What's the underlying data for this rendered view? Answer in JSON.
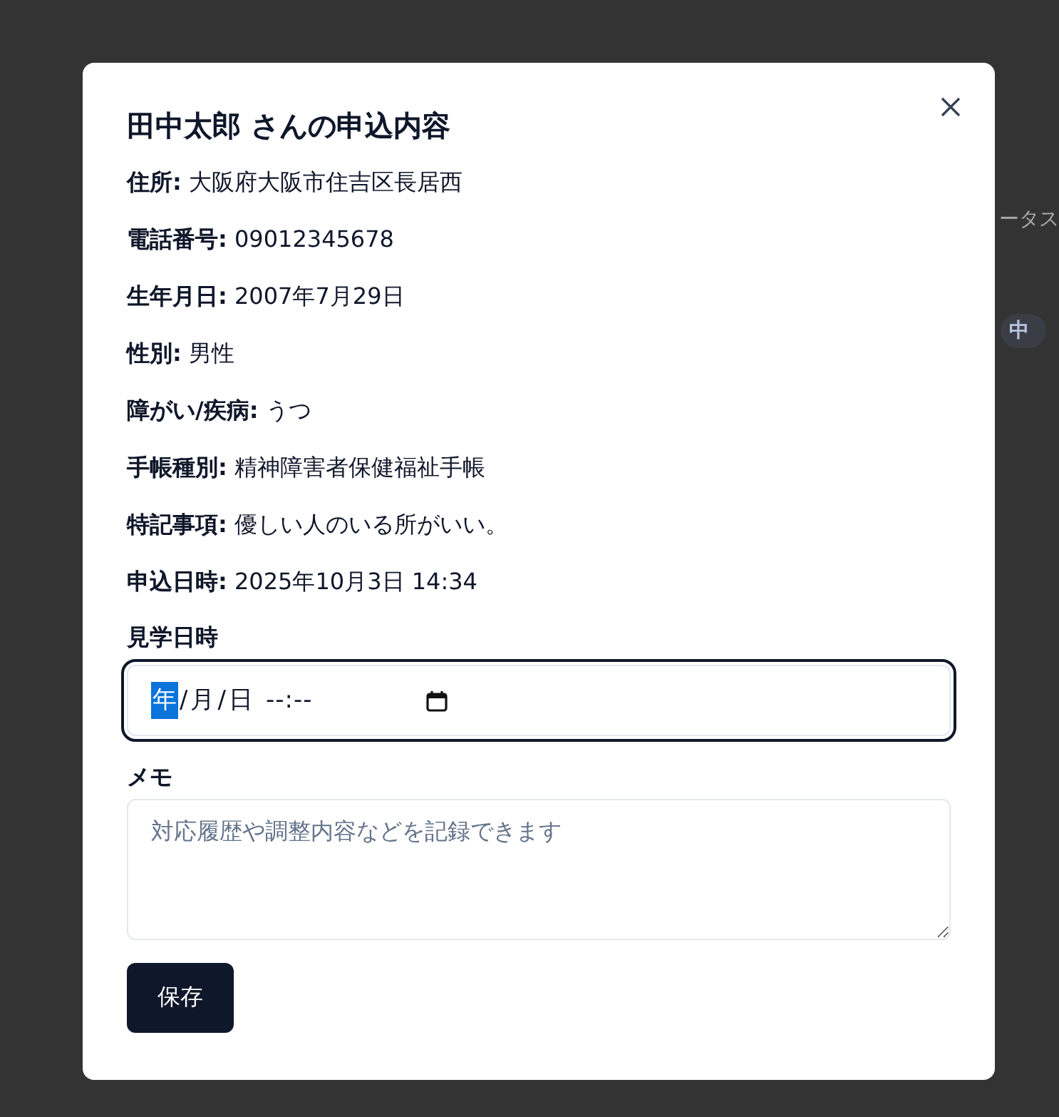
{
  "background": {
    "column_heading": "ータス",
    "status_badge": "中"
  },
  "dialog": {
    "title": "田中太郎 さんの申込内容",
    "details": [
      {
        "text": "**住所:** 大阪府大阪市住吉区長居西"
      },
      {
        "text": "**電話番号:** 09012345678"
      },
      {
        "text": "**生年月日:** 2007年7月29日"
      },
      {
        "text": "**性別:** 男性"
      },
      {
        "text": "**障がい/疾病:** うつ"
      },
      {
        "text": "**手帳種別:** 精神障害者保健福祉手帳"
      },
      {
        "text": "**特記事項:** 優しい人のいる所がいい。"
      },
      {
        "text": "**申込日時:** 2025年10月3日 14:34"
      }
    ],
    "visit_field": {
      "label": "見学日時",
      "focused": true,
      "segments": [
        {
          "text": "年",
          "selected": true
        },
        {
          "text": "/",
          "selected": false
        },
        {
          "text": "月",
          "selected": false
        },
        {
          "text": "/",
          "selected": false
        },
        {
          "text": "日",
          "selected": false
        }
      ],
      "time": "--:--"
    },
    "memo_field": {
      "label": "メモ",
      "placeholder": "対応履歴や調整内容などを記録できます"
    },
    "save_button": "保存"
  }
}
